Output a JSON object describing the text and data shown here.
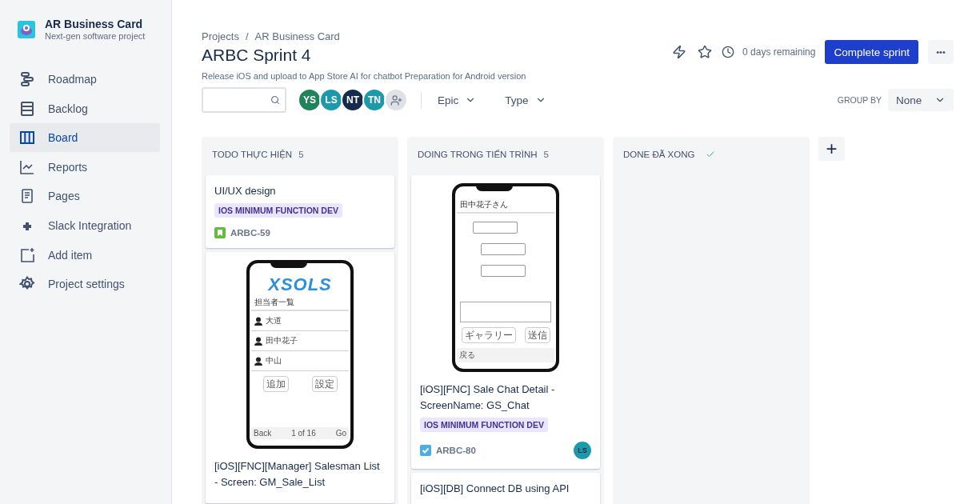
{
  "project": {
    "name": "AR Business Card",
    "subtitle": "Next-gen software project"
  },
  "sidebar": {
    "items": [
      {
        "kind": "roadmap",
        "label": "Roadmap",
        "selected": false
      },
      {
        "kind": "backlog",
        "label": "Backlog",
        "selected": false
      },
      {
        "kind": "board",
        "label": "Board",
        "selected": true
      },
      {
        "kind": "reports",
        "label": "Reports",
        "selected": false
      },
      {
        "kind": "pages",
        "label": "Pages",
        "selected": false
      },
      {
        "kind": "slack",
        "label": "Slack Integration",
        "selected": false
      },
      {
        "kind": "add",
        "label": "Add item",
        "selected": false
      },
      {
        "kind": "settings",
        "label": "Project settings",
        "selected": false
      }
    ]
  },
  "breadcrumbs": [
    "Projects",
    "AR Business Card"
  ],
  "breadcrumb_separator": "/",
  "sprint": {
    "title": "ARBC Sprint 4",
    "goal": "Release iOS and upload to App Store AI for chatbot Preparation for Android version",
    "remaining": "0 days remaining",
    "complete_button": "Complete sprint",
    "more_button": "•••"
  },
  "filters": {
    "avatars": [
      {
        "initials": "YS",
        "color": "#1f845a"
      },
      {
        "initials": "LS",
        "color": "#1d9aaa"
      },
      {
        "initials": "NT",
        "color": "#172b4d"
      },
      {
        "initials": "TN",
        "color": "#1d9aaa"
      }
    ],
    "dropdowns": [
      "Epic",
      "Type"
    ],
    "group_by_label": "GROUP BY",
    "group_by_value": "None"
  },
  "columns": [
    {
      "title": "TODO THỰC HIỆN",
      "count": "5",
      "cards": [
        {
          "title": "UI/UX design",
          "label": "IOS MINIMUM FUNCTION DEV",
          "kind": "story",
          "key": "ARBC-59"
        },
        {
          "mockup": {
            "kind": "list",
            "logo": "XSOLS",
            "heading": "担当者一覧",
            "rows": [
              "大道",
              "田中花子",
              "中山"
            ],
            "buttons": [
              "追加",
              "設定"
            ],
            "footer": [
              "Back",
              "1 of 16",
              "Go"
            ]
          },
          "title": "[iOS][FNC][Manager] Salesman List - Screen: GM_Sale_List"
        }
      ]
    },
    {
      "title": "DOING TRONG TIẾN TRÌNH",
      "count": "5",
      "cards": [
        {
          "mockup": {
            "kind": "chat",
            "heading": "田中花子さん",
            "buttons": [
              "ギャラリー",
              "送信"
            ],
            "footer": [
              "戻る"
            ]
          },
          "title": "[iOS][FNC] Sale Chat Detail - ScreenName: GS_Chat",
          "label": "IOS MINIMUM FUNCTION DEV",
          "kind": "task",
          "key": "ARBC-80",
          "assignee": {
            "initials": "LS",
            "color": "#1d9aaa"
          }
        },
        {
          "title": "[iOS][DB] Connect DB using API"
        }
      ]
    },
    {
      "title": "DONE ĐÃ XONG",
      "done": true
    }
  ],
  "add_column": "+"
}
